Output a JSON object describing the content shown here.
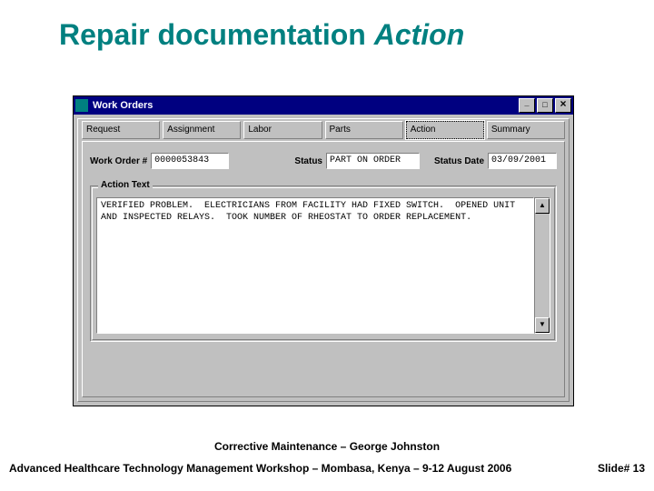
{
  "slide": {
    "title_plain": "Repair documentation ",
    "title_italic": "Action",
    "subtitle": "Corrective Maintenance – George Johnston",
    "workshop": "Advanced Healthcare Technology Management Workshop – Mombasa, Kenya – 9-12 August 2006",
    "slide_number": "Slide# 13"
  },
  "window": {
    "title": "Work Orders",
    "tabs": {
      "request": "Request",
      "assignment": "Assignment",
      "labor": "Labor",
      "parts": "Parts",
      "action": "Action",
      "summary": "Summary"
    },
    "fields": {
      "work_order_label": "Work Order #",
      "work_order_value": "0000053843",
      "status_label": "Status",
      "status_value": "PART ON ORDER",
      "status_date_label": "Status Date",
      "status_date_value": "03/09/2001"
    },
    "action_group": {
      "label": "Action Text",
      "text": "VERIFIED PROBLEM.  ELECTRICIANS FROM FACILITY HAD FIXED SWITCH.  OPENED UNIT AND INSPECTED RELAYS.  TOOK NUMBER OF RHEOSTAT TO ORDER REPLACEMENT."
    }
  }
}
